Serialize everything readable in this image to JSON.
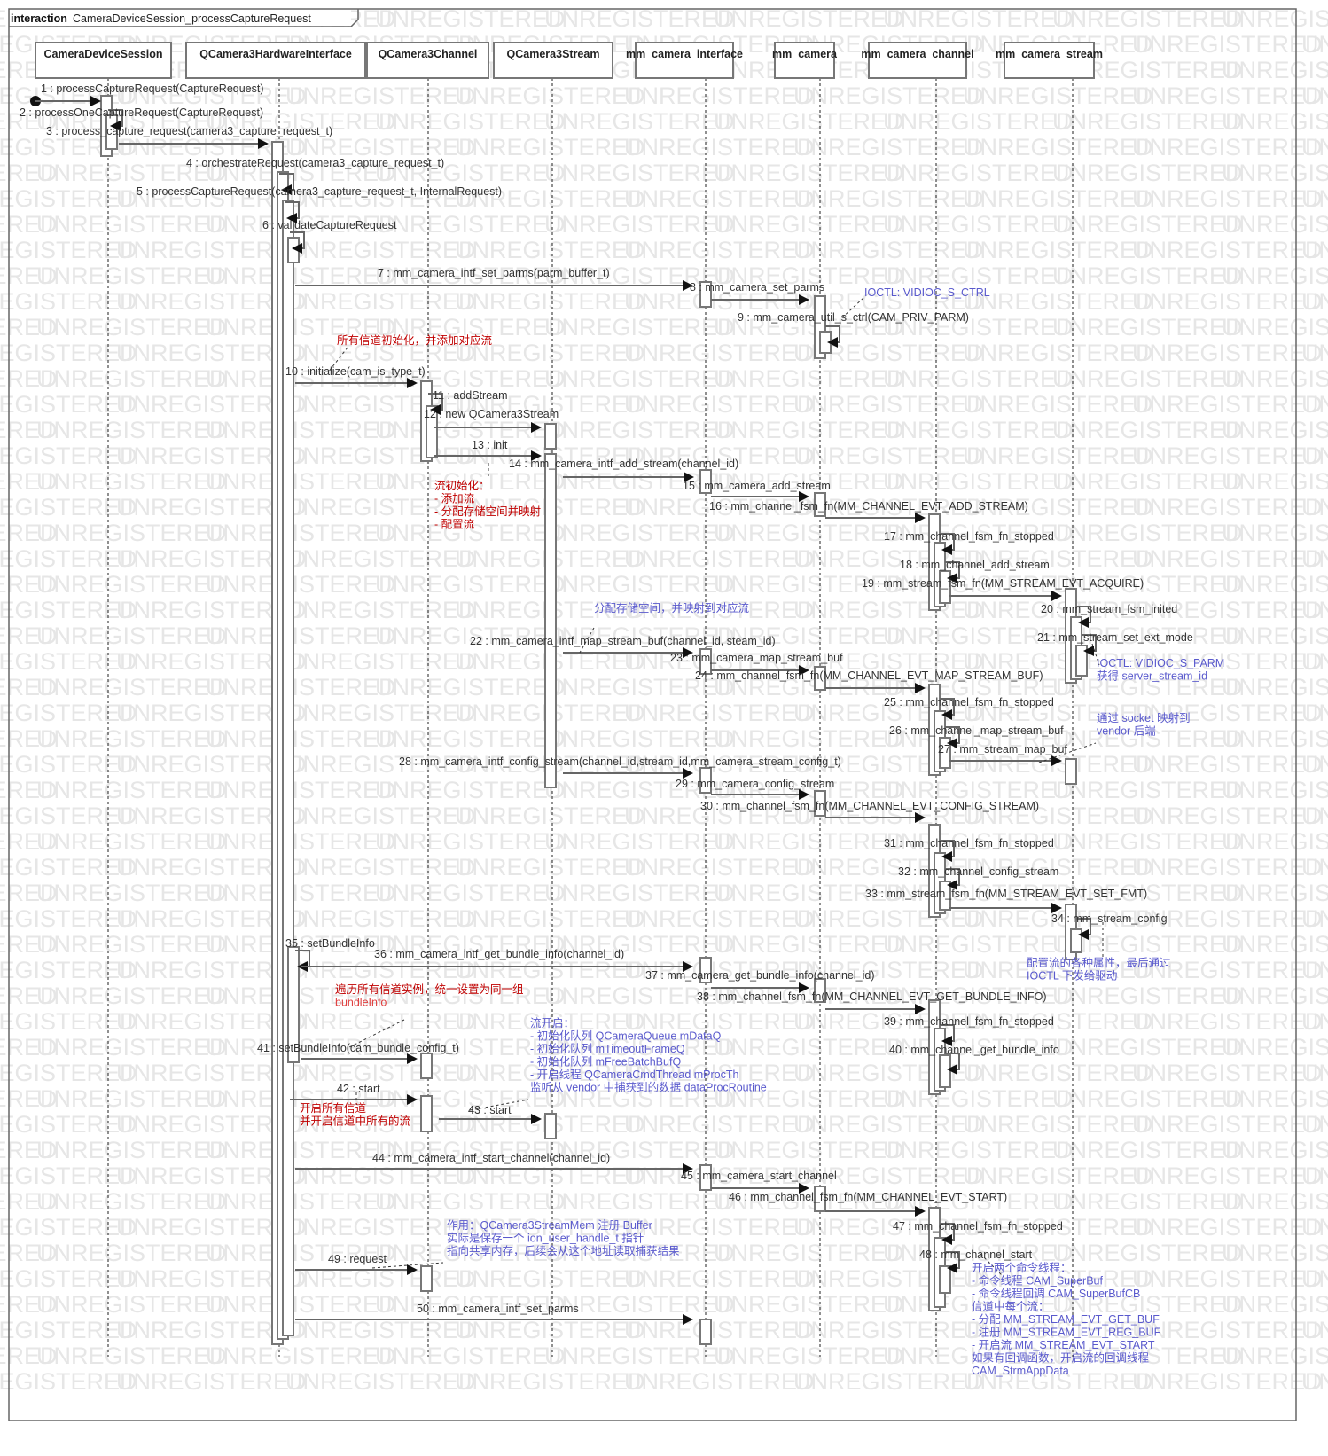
{
  "frame": {
    "keyword": "interaction",
    "name": "CameraDeviceSession_processCaptureRequest"
  },
  "watermark": "UNREGISTERED",
  "lifelines": [
    {
      "id": "cds",
      "name": "CameraDeviceSession"
    },
    {
      "id": "hwi",
      "name": "QCamera3HardwareInterface"
    },
    {
      "id": "ch",
      "name": "QCamera3Channel"
    },
    {
      "id": "st",
      "name": "QCamera3Stream"
    },
    {
      "id": "mci",
      "name": "mm_camera_interface"
    },
    {
      "id": "mc",
      "name": "mm_camera"
    },
    {
      "id": "mcc",
      "name": "mm_camera_channel"
    },
    {
      "id": "mcs",
      "name": "mm_camera_stream"
    }
  ],
  "messages": [
    {
      "n": 1,
      "label": "1 : processCaptureRequest(CaptureRequest)",
      "from": "start",
      "to": "cds"
    },
    {
      "n": 2,
      "label": "2 : processOneCaptureRequest(CaptureRequest)",
      "from": "cds",
      "to": "cds"
    },
    {
      "n": 3,
      "label": "3 : process_capture_request(camera3_capture_request_t)",
      "from": "cds",
      "to": "hwi"
    },
    {
      "n": 4,
      "label": "4 : orchestrateRequest(camera3_capture_request_t)",
      "from": "hwi",
      "to": "hwi"
    },
    {
      "n": 5,
      "label": "5 : processCaptureRequest(camera3_capture_request_t, InternalRequest)",
      "from": "hwi",
      "to": "hwi"
    },
    {
      "n": 6,
      "label": "6 : validateCaptureRequest",
      "from": "hwi",
      "to": "hwi"
    },
    {
      "n": 7,
      "label": "7 : mm_camera_intf_set_parms(parm_buffer_t)",
      "from": "hwi",
      "to": "mci"
    },
    {
      "n": 8,
      "label": "8 : mm_camera_set_parms",
      "from": "mci",
      "to": "mc"
    },
    {
      "n": 9,
      "label": "9 : mm_camera_util_s_ctrl(CAM_PRIV_PARM)",
      "from": "mc",
      "to": "mc"
    },
    {
      "n": 10,
      "label": "10 : initialize(cam_is_type_t)",
      "from": "hwi",
      "to": "ch"
    },
    {
      "n": 11,
      "label": "11 : addStream",
      "from": "ch",
      "to": "ch"
    },
    {
      "n": 12,
      "label": "12 : new QCamera3Stream",
      "from": "ch",
      "to": "st"
    },
    {
      "n": 13,
      "label": "13 : init",
      "from": "ch",
      "to": "st"
    },
    {
      "n": 14,
      "label": "14 : mm_camera_intf_add_stream(channel_id)",
      "from": "st",
      "to": "mci"
    },
    {
      "n": 15,
      "label": "15 : mm_camera_add_stream",
      "from": "mci",
      "to": "mc"
    },
    {
      "n": 16,
      "label": "16 : mm_channel_fsm_fn(MM_CHANNEL_EVT_ADD_STREAM)",
      "from": "mc",
      "to": "mcc"
    },
    {
      "n": 17,
      "label": "17 : mm_channel_fsm_fn_stopped",
      "from": "mcc",
      "to": "mcc"
    },
    {
      "n": 18,
      "label": "18 : mm_channel_add_stream",
      "from": "mcc",
      "to": "mcc"
    },
    {
      "n": 19,
      "label": "19 : mm_stream_fsm_fn(MM_STREAM_EVT_ACQUIRE)",
      "from": "mcc",
      "to": "mcs"
    },
    {
      "n": 20,
      "label": "20 : mm_stream_fsm_inited",
      "from": "mcs",
      "to": "mcs"
    },
    {
      "n": 21,
      "label": "21 : mm_stream_set_ext_mode",
      "from": "mcs",
      "to": "mcs"
    },
    {
      "n": 22,
      "label": "22 : mm_camera_intf_map_stream_buf(channel_id, steam_id)",
      "from": "st",
      "to": "mci"
    },
    {
      "n": 23,
      "label": "23 : mm_camera_map_stream_buf",
      "from": "mci",
      "to": "mc"
    },
    {
      "n": 24,
      "label": "24 : mm_channel_fsm_fn(MM_CHANNEL_EVT_MAP_STREAM_BUF)",
      "from": "mc",
      "to": "mcc"
    },
    {
      "n": 25,
      "label": "25 : mm_channel_fsm_fn_stopped",
      "from": "mcc",
      "to": "mcc"
    },
    {
      "n": 26,
      "label": "26 : mm_channel_map_stream_buf",
      "from": "mcc",
      "to": "mcc"
    },
    {
      "n": 27,
      "label": "27 : mm_stream_map_buf",
      "from": "mcc",
      "to": "mcs"
    },
    {
      "n": 28,
      "label": "28 : mm_camera_intf_config_stream(channel_id,stream_id,mm_camera_stream_config_t)",
      "from": "st",
      "to": "mci"
    },
    {
      "n": 29,
      "label": "29 : mm_camera_config_stream",
      "from": "mci",
      "to": "mc"
    },
    {
      "n": 30,
      "label": "30 : mm_channel_fsm_fn(MM_CHANNEL_EVT_CONFIG_STREAM)",
      "from": "mc",
      "to": "mcc"
    },
    {
      "n": 31,
      "label": "31 : mm_channel_fsm_fn_stopped",
      "from": "mcc",
      "to": "mcc"
    },
    {
      "n": 32,
      "label": "32 : mm_channel_config_stream",
      "from": "mcc",
      "to": "mcc"
    },
    {
      "n": 33,
      "label": "33 : mm_stream_fsm_fn(MM_STREAM_EVT_SET_FMT)",
      "from": "mcc",
      "to": "mcs"
    },
    {
      "n": 34,
      "label": "34 : mm_stream_config",
      "from": "mcs",
      "to": "mcs"
    },
    {
      "n": 35,
      "label": "35 : setBundleInfo",
      "from": "hwi",
      "to": "hwi"
    },
    {
      "n": 36,
      "label": "36 : mm_camera_intf_get_bundle_info(channel_id)",
      "from": "hwi",
      "to": "mci"
    },
    {
      "n": 37,
      "label": "37 : mm_camera_get_bundle_info(channel_id)",
      "from": "mci",
      "to": "mc"
    },
    {
      "n": 38,
      "label": "38 : mm_channel_fsm_fn(MM_CHANNEL_EVT_GET_BUNDLE_INFO)",
      "from": "mc",
      "to": "mcc"
    },
    {
      "n": 39,
      "label": "39 : mm_channel_fsm_fn_stopped",
      "from": "mcc",
      "to": "mcc"
    },
    {
      "n": 40,
      "label": "40 : mm_channel_get_bundle_info",
      "from": "mcc",
      "to": "mcc"
    },
    {
      "n": 41,
      "label": "41 : setBundleInfo(cam_bundle_config_t)",
      "from": "hwi",
      "to": "ch"
    },
    {
      "n": 42,
      "label": "42 : start",
      "from": "hwi",
      "to": "ch"
    },
    {
      "n": 43,
      "label": "43 : start",
      "from": "ch",
      "to": "st"
    },
    {
      "n": 44,
      "label": "44 : mm_camera_intf_start_channel(channel_id)",
      "from": "hwi",
      "to": "mci"
    },
    {
      "n": 45,
      "label": "45 : mm_camera_start_channel",
      "from": "mci",
      "to": "mc"
    },
    {
      "n": 46,
      "label": "46 : mm_channel_fsm_fn(MM_CHANNEL_EVT_START)",
      "from": "mc",
      "to": "mcc"
    },
    {
      "n": 47,
      "label": "47 : mm_channel_fsm_fn_stopped",
      "from": "mcc",
      "to": "mcc"
    },
    {
      "n": 48,
      "label": "48 : mm_channel_start",
      "from": "mcc",
      "to": "mcc"
    },
    {
      "n": 49,
      "label": "49 : request",
      "from": "hwi",
      "to": "ch"
    },
    {
      "n": 50,
      "label": "50 : mm_camera_intf_set_parms",
      "from": "hwi",
      "to": "mci"
    }
  ],
  "notes": [
    {
      "id": "n-ioctl-sctrl",
      "color": "blue",
      "lines": [
        "IOCTL: VIDIOC_S_CTRL"
      ]
    },
    {
      "id": "n-init-channels",
      "color": "red",
      "lines": [
        "所有信道初始化，并添加对应流"
      ]
    },
    {
      "id": "n-stream-init",
      "color": "red",
      "lines": [
        "流初始化：",
        "- 添加流",
        "- 分配存储空间并映射",
        "- 配置流"
      ]
    },
    {
      "id": "n-alloc-map",
      "color": "blue",
      "lines": [
        "分配存储空间，并映射到对应流"
      ]
    },
    {
      "id": "n-ioctl-sparm",
      "color": "blue",
      "lines": [
        "IOCTL: VIDIOC_S_PARM",
        "获得 server_stream_id"
      ]
    },
    {
      "id": "n-socket-map",
      "color": "blue",
      "lines": [
        "通过 socket 映射到",
        "vendor 后端"
      ]
    },
    {
      "id": "n-config-attrs",
      "color": "blue",
      "lines": [
        "配置流的各种属性，最后通过",
        "IOCTL 下发给驱动"
      ]
    },
    {
      "id": "n-bundle",
      "color": "red",
      "lines": [
        "遍历所有信道实例，统一设置为同一组",
        "bundleInfo"
      ]
    },
    {
      "id": "n-stream-start",
      "color": "blue",
      "lines": [
        "流开启：",
        "- 初始化队列 QCameraQueue mDataQ",
        "- 初始化队列 mTimeoutFrameQ",
        "- 初始化队列 mFreeBatchBufQ",
        "- 开启线程 QCameraCmdThread mProcTh",
        "  监听从 vendor 中捕获到的数据 dataProcRoutine"
      ]
    },
    {
      "id": "n-start-channels",
      "color": "red",
      "lines": [
        "开启所有信道",
        "并开启信道中所有的流"
      ]
    },
    {
      "id": "n-request",
      "color": "blue",
      "lines": [
        "作用：QCamera3StreamMem 注册 Buffer",
        "实际是保存一个 ion_user_handle_t 指针",
        "指向共享内存，后续会从这个地址读取捕获结果"
      ]
    },
    {
      "id": "n-channel-start",
      "color": "blue",
      "lines": [
        "开启两个命令线程：",
        "- 命令线程 CAM_SuperBuf",
        "- 命令线程回调 CAM_SuperBufCB",
        "信道中每个流：",
        "- 分配 MM_STREAM_EVT_GET_BUF",
        "- 注册 MM_STREAM_EVT_REG_BUF",
        "- 开启流 MM_STREAM_EVT_START",
        "   如果有回调函数，开启流的回调线程",
        "CAM_StrmAppData"
      ]
    }
  ]
}
